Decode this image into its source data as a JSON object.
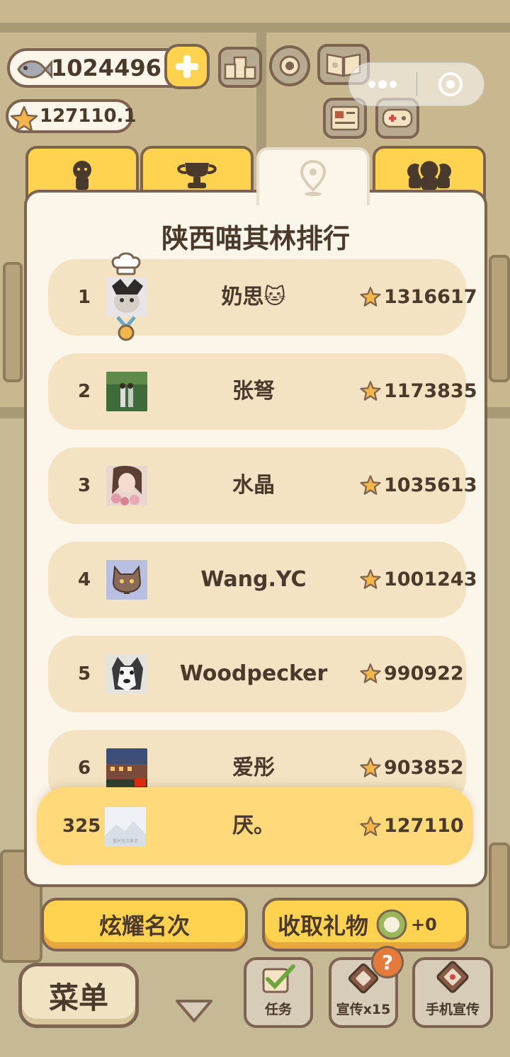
{
  "hud": {
    "fish_amount": "1024496",
    "star_amount": "127110.1"
  },
  "tabs": [
    {
      "icon": "person-icon",
      "active": false
    },
    {
      "icon": "trophy-icon",
      "active": false
    },
    {
      "icon": "location-pin-icon",
      "active": true
    },
    {
      "icon": "group-icon",
      "active": false
    }
  ],
  "leaderboard": {
    "title": "陕西喵其林排行",
    "rows": [
      {
        "rank": "1",
        "name": "奶思🐱",
        "score": "1316617"
      },
      {
        "rank": "2",
        "name": "张弩",
        "score": "1173835"
      },
      {
        "rank": "3",
        "name": "水晶",
        "score": "1035613"
      },
      {
        "rank": "4",
        "name": "Wang.YC",
        "score": "1001243"
      },
      {
        "rank": "5",
        "name": "Woodpecker",
        "score": "990922"
      },
      {
        "rank": "6",
        "name": "爱彤",
        "score": "903852"
      }
    ],
    "me": {
      "rank": "325",
      "name": "厌。",
      "score": "127110",
      "avatar_placeholder_text": "暂时无法显示"
    }
  },
  "buttons": {
    "show_rank": "炫耀名次",
    "collect_gift": "收取礼物",
    "gift_count": "+0",
    "menu": "菜单",
    "task": "任务",
    "promote": "宣传x15",
    "phone_promote": "手机宣传",
    "alert_mark": "?"
  },
  "colors": {
    "accent_yellow": "#ffd24f",
    "panel_bg": "#fbf5ea",
    "row_bg": "#f3e3c2",
    "my_row_bg": "#ffd97a",
    "outline_brown": "#7d6450",
    "text_dark": "#4a3a2c"
  }
}
